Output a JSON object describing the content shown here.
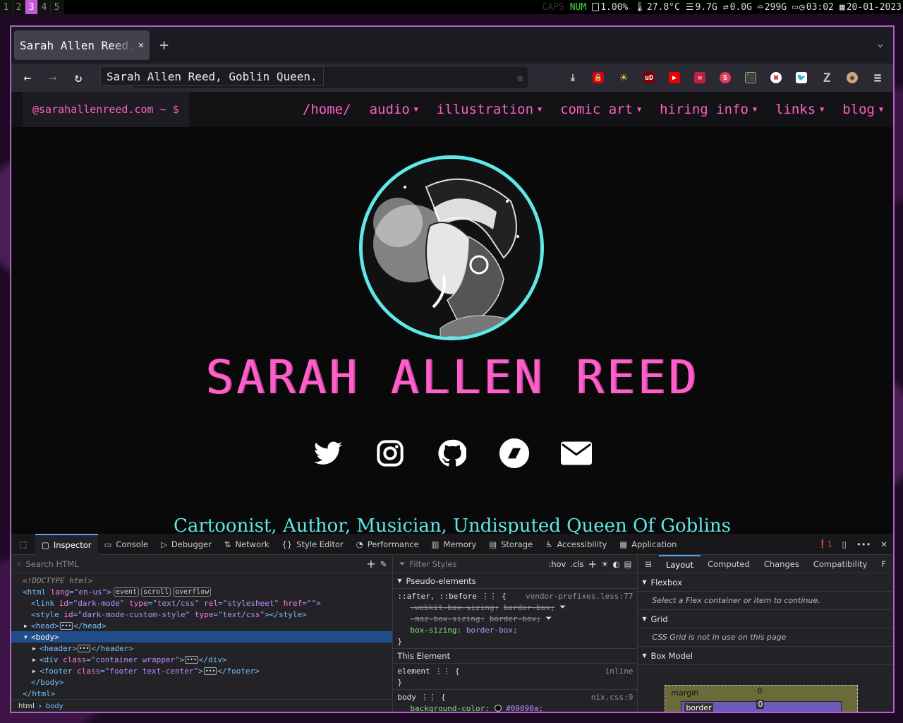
{
  "statusbar": {
    "workspaces": [
      "1",
      "2",
      "3",
      "4",
      "5"
    ],
    "active_workspace": "3",
    "caps": "CAPS",
    "num": "NUM",
    "cpu": "1.00%",
    "temp": "27.8°C",
    "mem": "9.7G",
    "swap": "0.0G",
    "disk": "299G",
    "time": "03:02",
    "date": "20-01-2023"
  },
  "browser": {
    "tab_title": "Sarah Allen Reed, Goblin Queen.",
    "tab_title_visible": "Sarah Allen Reed, Go",
    "tooltip": "Sarah Allen Reed, Goblin Queen."
  },
  "site": {
    "brand": "@sarahallenreed.com ~ $",
    "nav": [
      "/home/",
      "audio",
      "illustration",
      "comic art",
      "hiring info",
      "links",
      "blog"
    ],
    "title": "SARAH ALLEN REED",
    "tagline": "Cartoonist, Author, Musician, Undisputed Queen Of Goblins",
    "socials": [
      "twitter-icon",
      "instagram-icon",
      "github-icon",
      "ko-fi-icon",
      "mail-icon"
    ],
    "colors": {
      "accent": "#ff5fc8",
      "cyan": "#5fe8e8",
      "bg": "#09090a"
    }
  },
  "devtools": {
    "tabs": [
      "Inspector",
      "Console",
      "Debugger",
      "Network",
      "Style Editor",
      "Performance",
      "Memory",
      "Storage",
      "Accessibility",
      "Application"
    ],
    "error_count": "1",
    "search_placeholder": "Search HTML",
    "filter_placeholder": "Filter Styles",
    "hov": ":hov",
    "cls": ".cls",
    "tree": {
      "doctype": "<!DOCTYPE html>",
      "html_open": "<html",
      "html_lang_attr": "lang",
      "html_lang_val": "\"en-us\"",
      "badges": [
        "event",
        "scroll",
        "overflow"
      ],
      "link_line_tag": "<link",
      "link_id": "\"dark-mode\"",
      "link_type": "\"text/css\"",
      "link_rel": "\"stylesheet\"",
      "link_href": "\"\"",
      "style_id": "\"dark-mode-custom-style\"",
      "style_type": "\"text/css\"",
      "head": "<head>",
      "head_close": "</head>",
      "body": "<body>",
      "header": "<header>",
      "header_close": "</header>",
      "div_class": "\"container wrapper\"",
      "div_close": "</div>",
      "footer_class": "\"footer text-center\"",
      "footer_close": "</footer>",
      "body_close": "</body>",
      "html_close": "</html>"
    },
    "crumbs": [
      "html",
      "body"
    ],
    "rules": {
      "pseudo_head": "Pseudo-elements",
      "pseudo_selector": "::after, ::before",
      "pseudo_src": "vendor-prefixes.less:77",
      "webkit": "-webkit-box-sizing:",
      "moz": "-moz-box-sizing:",
      "bb": "border-box;",
      "box_sizing": "box-sizing:",
      "box_sizing_val": "border-box;",
      "this_element": "This Element",
      "element": "element",
      "inline": "inline",
      "body_sel": "body",
      "body_src": "nix.css:9",
      "bgcolor": "background-color:",
      "bgcolor_val": "#09090a;"
    },
    "layout": {
      "tabs": [
        "Layout",
        "Computed",
        "Changes",
        "Compatibility",
        "F"
      ],
      "flexbox": "Flexbox",
      "flex_msg": "Select a Flex container or item to continue.",
      "grid": "Grid",
      "grid_msg": "CSS Grid is not in use on this page",
      "boxmodel": "Box Model",
      "margin": "margin",
      "margin_val": "0",
      "border": "border",
      "border_val": "0"
    }
  }
}
